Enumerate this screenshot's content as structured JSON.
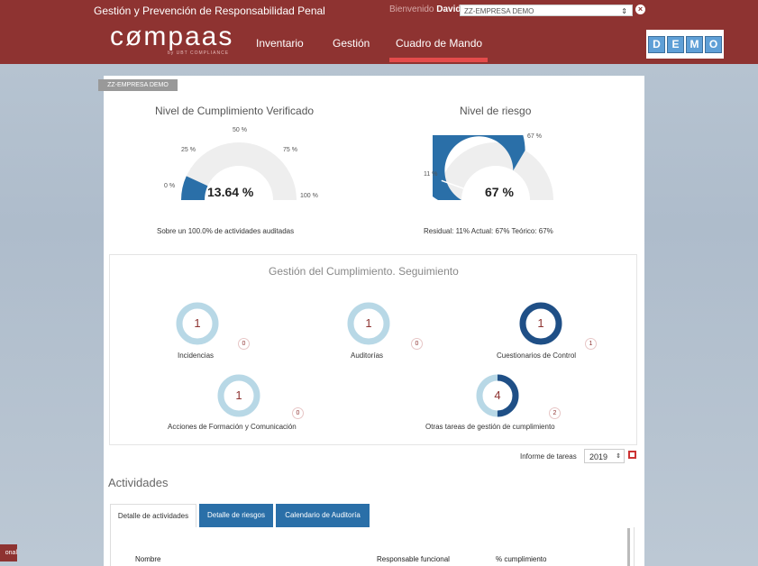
{
  "header": {
    "app_title": "Gestión y Prevención de Responsabilidad Penal",
    "welcome_prefix": "Bienvenido",
    "user_name": "David",
    "company": "ZZ-EMPRESA DEMO",
    "logo_text": "cømpaas",
    "logo_sub": "by UBT COMPLIANCE",
    "nav": [
      {
        "label": "Inventario"
      },
      {
        "label": "Gestión"
      },
      {
        "label": "Cuadro de Mando"
      }
    ],
    "demo_letters": [
      "D",
      "E",
      "M",
      "O"
    ]
  },
  "company_chip": "ZZ-EMPRESA DEMO",
  "gauges": {
    "compliance": {
      "title": "Nivel de Cumplimiento Verificado",
      "value": "13.64 %",
      "fraction": 0.1364,
      "ticks": [
        "0 %",
        "25 %",
        "50 %",
        "75 %",
        "100 %"
      ],
      "caption": "Sobre un 100.0% de actividades auditadas"
    },
    "risk": {
      "title": "Nivel de riesgo",
      "value": "67 %",
      "fraction": 0.67,
      "residual_fraction": 0.11,
      "ticks": [
        "11 %",
        "67 %"
      ],
      "caption": "Residual: 11% Actual: 67% Teórico: 67%"
    }
  },
  "tracking": {
    "title": "Gestión del Cumplimiento. Seguimiento",
    "items": [
      {
        "label": "Incidencias",
        "value": "1",
        "badge": "0"
      },
      {
        "label": "Auditorías",
        "value": "1",
        "badge": "0"
      },
      {
        "label": "Cuestionarios de Control",
        "value": "1",
        "badge": "1"
      },
      {
        "label": "Acciones de Formación y Comunicación",
        "value": "1",
        "badge": "0"
      },
      {
        "label": "Otras tareas de gestión de cumplimiento",
        "value": "4",
        "badge": "2"
      }
    ]
  },
  "report": {
    "label": "Informe de tareas",
    "year": "2019"
  },
  "activities": {
    "title": "Actividades",
    "tabs": [
      {
        "label": "Detalle de actividades"
      },
      {
        "label": "Detalle de riesgos"
      },
      {
        "label": "Calendario de Auditoría"
      }
    ],
    "columns": [
      "Nombre",
      "Responsable funcional",
      "% cumplimiento"
    ]
  },
  "side_label": "onal",
  "colors": {
    "brand": "#8e3331",
    "gauge_blue": "#2a6fa8",
    "ring_light": "#b8d8e6",
    "ring_dark": "#1f4f86"
  }
}
